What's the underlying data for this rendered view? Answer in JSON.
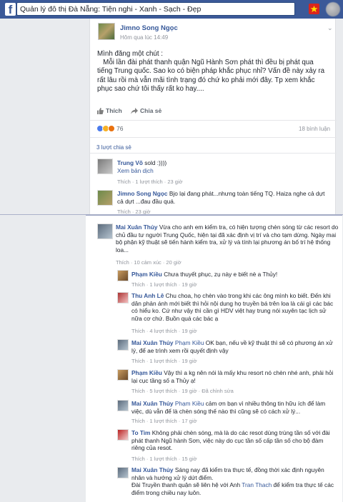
{
  "topbar": {
    "logo": "f",
    "search_value": "Quản lý đô thị Đà Nẵng: Tiện nghi - Xanh - Sạch - Đẹp"
  },
  "post": {
    "author": "Jimno Song Ngọc",
    "time": "Hôm qua lúc 14:49",
    "body": "Mình đăng một chút :\n   Mỗi lần đài phát thanh quận Ngũ Hành Sơn phát thì đều bị phát qua tiếng Trung quốc. Sao ko có biện pháp khắc phục nhỉ? Vấn đề này xảy ra rất lâu rồi mà vẫn mãi tình trạng đó chứ ko phải mới đây. Tp xem khắc phục sao chứ tôi thấy rất ko hay....",
    "like_label": "Thích",
    "share_label": "Chia sẻ",
    "reaction_count": "76",
    "comments_count": "18 bình luận",
    "shares_label": "3 lượt chia sẻ"
  },
  "comments": [
    {
      "author": "Trung Võ",
      "text": "sold :))))",
      "translate": "Xem bản dịch",
      "meta": "Thích · 1 lượt thích · 23 giờ"
    },
    {
      "author": "Jimno Song Ngọc",
      "text": "Bjo lại đang phát...nhưng toàn tiếng TQ. Haiza nghe cả dựt cả dựt ...đau đầu quá.",
      "meta": "Thích · 23 giờ"
    }
  ],
  "thread": {
    "main": {
      "author": "Mai Xuân Thủy",
      "text": "Vừa cho anh em kiểm tra, có hiện tượng chèn sóng từ các resort do chủ đầu tư người Trung Quốc, hiện tại đã xác định vị trí và cho tạm dừng. Ngày mai bộ phận kỹ thuật sẽ tiến hành kiểm tra, xử lý và tính lại phương án bố trí hệ thống loa...",
      "meta": "Thích · 10 cảm xúc · 20 giờ"
    },
    "replies": [
      {
        "author": "Phạm Kiều",
        "text": "Chưa thuyết phục, zụ này e biết nè a Thủy!",
        "meta": "Thích · 1 lượt thích · 19 giờ"
      },
      {
        "author": "Thu Anh Lê",
        "text": "Chu choa, họ chèn vào trong khi các ông mình ko biết. Đến khi dân phản ánh mới biết thì hỏi nội dung họ truyền bá trên loa là cái gì các bác có hiểu ko. Cứ như vậy thì cần gì HDV việt hay trung nói xuyên tạc lịch sử nữa cơ chứ. Buồn quá các bác ạ",
        "meta": "Thích · 4 lượt thích · 19 giờ"
      },
      {
        "author": "Mai Xuân Thủy",
        "mention": "Phạm Kiều",
        "text": "OK bạn, nếu về kỹ thuật thì sẽ có phương án xử lý, để ae trình xem rồi quyết định vậy",
        "meta": "Thích · 1 lượt thích · 19 giờ"
      },
      {
        "author": "Phạm Kiều",
        "text": "Vậy thì a kg nên nói là mấy khu resort nó chèn nhé anh, phải hỏi lại cục tầng số a Thủy ạ!",
        "meta": "Thích · 5 lượt thích · 19 giờ · Đã chỉnh sửa"
      },
      {
        "author": "Mai Xuân Thủy",
        "mention": "Phạm Kiều",
        "text": "cảm ơn bạn vì nhiều thông tin hữu ích để làm việc, dù vẫn để là chèn sóng thế nào thì cũng sẽ có cách xử lý...",
        "meta": "Thích · 1 lượt thích · 17 giờ"
      },
      {
        "author": "To Tim",
        "text": "Không phải chèn sóng, mà là do các resot dùng trùng tần số với đài phát thanh Ngũ hành Sơn, việc này do cục tần số cấp tần số cho bộ đàm riêng của resot.",
        "meta": "Thích · 1 lượt thích · 15 giờ"
      },
      {
        "author": "Mai Xuân Thủy",
        "text": "Sáng nay đã kiểm tra thực tế, đồng thời xác định nguyên nhân và hướng xử lý dứt điểm.",
        "text2_pre": "Đài Truyền thanh quận sẽ liên hệ với Anh ",
        "text2_mention": "Tran Thach",
        "text2_post": " để kiểm tra thực tế các điểm trong chiều nay luôn."
      }
    ]
  },
  "colors": {
    "topbar": "#3b5998",
    "link": "#365899",
    "meta": "#90949c"
  },
  "icons": [
    "facebook-logo-icon",
    "vn-flag-icon",
    "like-icon",
    "share-icon",
    "chevron-down-icon"
  ]
}
